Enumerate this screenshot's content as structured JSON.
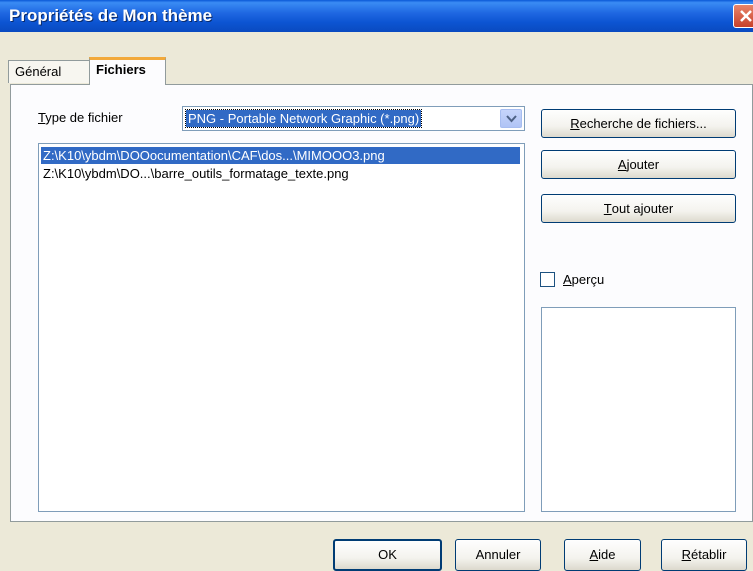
{
  "window": {
    "title": "Propriétés de Mon thème"
  },
  "tabs": [
    {
      "label": "Général",
      "active": false
    },
    {
      "label": "Fichiers",
      "active": true
    }
  ],
  "file_type": {
    "label_first": "T",
    "label_rest": "ype de fichier",
    "selected_value": "PNG - Portable Network Graphic (*.png)"
  },
  "file_list": [
    {
      "path": "Z:\\K10\\ybdm\\DOOocumentation\\CAF\\dos...\\MIMOOO3.png",
      "selected": true
    },
    {
      "path": "Z:\\K10\\ybdm\\DO...\\barre_outils_formatage_texte.png",
      "selected": false
    }
  ],
  "buttons": {
    "recherche": {
      "first": "R",
      "rest": "echerche de fichiers..."
    },
    "ajouter": {
      "first": "A",
      "rest": "jouter"
    },
    "tout_ajouter": {
      "first": "T",
      "rest": "out ajouter"
    },
    "ok": "OK",
    "annuler": "Annuler",
    "aide": {
      "first": "A",
      "rest": "ide"
    },
    "retablir": {
      "first": "R",
      "rest": "établir"
    }
  },
  "preview": {
    "checkbox_first": "A",
    "checkbox_rest": "perçu",
    "checked": false
  }
}
